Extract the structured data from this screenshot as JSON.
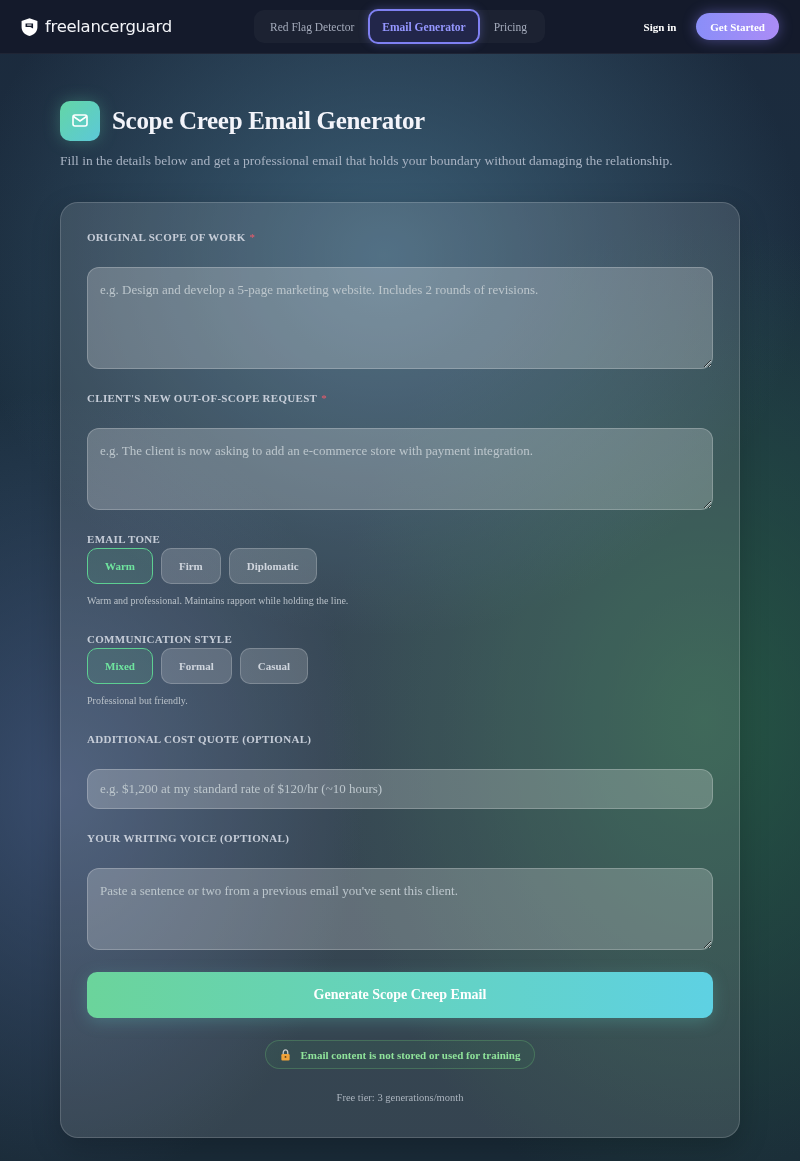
{
  "nav": {
    "logo": "freelancerguard",
    "tabs": [
      {
        "label": "Red Flag Detector",
        "selected": false
      },
      {
        "label": "Email Generator",
        "selected": true
      },
      {
        "label": "Pricing",
        "selected": false
      }
    ],
    "sign_in": "Sign in",
    "cta": "Get Started"
  },
  "header": {
    "title": "Scope Creep Email Generator",
    "subtitle": "Fill in the details below and get a professional email that holds your boundary without damaging the relationship."
  },
  "form": {
    "fields": [
      {
        "kind": "textarea",
        "label": "ORIGINAL SCOPE OF WORK",
        "required_mark": "*",
        "placeholder": "e.g. Design and develop a 5-page marketing website. Includes 2 rounds of revisions."
      },
      {
        "kind": "textarea",
        "label": "CLIENT'S NEW OUT-OF-SCOPE REQUEST",
        "required_mark": "*",
        "placeholder": "e.g. The client is now asking to add an e-commerce store with payment integration."
      },
      {
        "kind": "choice",
        "label": "EMAIL TONE",
        "options": [
          {
            "label": "Warm",
            "selected": true
          },
          {
            "label": "Firm",
            "selected": false
          },
          {
            "label": "Diplomatic",
            "selected": false
          }
        ],
        "hint": "Warm and professional. Maintains rapport while holding the line."
      },
      {
        "kind": "choice",
        "label": "COMMUNICATION STYLE",
        "options": [
          {
            "label": "Mixed",
            "selected": true
          },
          {
            "label": "Formal",
            "selected": false
          },
          {
            "label": "Casual",
            "selected": false
          }
        ],
        "hint": "Professional but friendly."
      },
      {
        "kind": "input",
        "label": "ADDITIONAL COST QUOTE (OPTIONAL)",
        "placeholder": "e.g. $1,200 at my standard rate of $120/hr (~10 hours)"
      },
      {
        "kind": "textarea",
        "label": "YOUR WRITING VOICE (OPTIONAL)",
        "placeholder": "Paste a sentence or two from a previous email you've sent this client."
      }
    ],
    "submit": "Generate Scope Creep Email",
    "privacy_note": "Email content is not stored or used for training",
    "quota": "Free tier: 3 generations/month"
  }
}
